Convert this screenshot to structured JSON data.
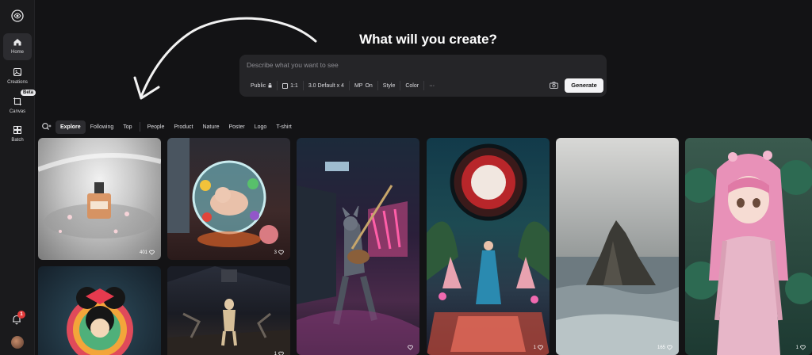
{
  "sidebar": {
    "items": [
      {
        "label": "Home",
        "icon": "home-icon"
      },
      {
        "label": "Creations",
        "icon": "image-icon"
      },
      {
        "label": "Canvas",
        "icon": "canvas-icon",
        "badge": "Beta"
      },
      {
        "label": "Batch",
        "icon": "batch-icon"
      }
    ],
    "notification_count": "1"
  },
  "prompt": {
    "headline": "What will you create?",
    "placeholder": "Describe what you want to see",
    "options": {
      "visibility": "Public",
      "ratio": "1:1",
      "model": "3.0 Default x 4",
      "mp_label": "MP",
      "mp_value": "On",
      "style": "Style",
      "color": "Color",
      "more": "···"
    },
    "generate_label": "Generate"
  },
  "filters": {
    "tabs": [
      "Explore",
      "Following",
      "Top"
    ],
    "categories": [
      "People",
      "Product",
      "Nature",
      "Poster",
      "Logo",
      "T-shirt"
    ],
    "active": "Explore"
  },
  "gallery": [
    {
      "subject": "perfume-bottle",
      "likes": "401"
    },
    {
      "subject": "baby-in-glass-sphere",
      "likes": "3"
    },
    {
      "subject": "minnie-mouse-yarn",
      "likes": ""
    },
    {
      "subject": "warrior-statue",
      "likes": "1"
    },
    {
      "subject": "wolf-guitarist",
      "likes": ""
    },
    {
      "subject": "portal-woman",
      "likes": "1"
    },
    {
      "subject": "sea-rock",
      "likes": "165"
    },
    {
      "subject": "pink-anime-girl",
      "likes": "1"
    }
  ],
  "colors": {
    "background": "#131315",
    "panel": "#252528",
    "accent": "#f4f4f6"
  }
}
